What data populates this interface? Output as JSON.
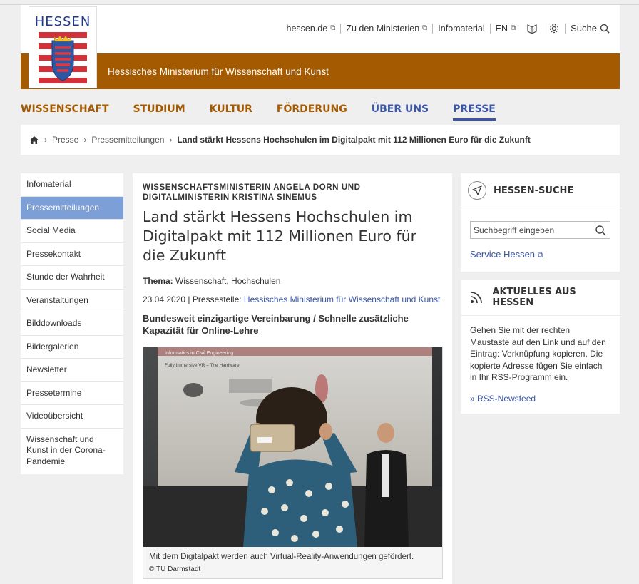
{
  "header": {
    "logo_text": "HESSEN",
    "utility": [
      {
        "label": "hessen.de",
        "external": true
      },
      {
        "label": "Zu den Ministerien",
        "external": true
      },
      {
        "label": "Infomaterial",
        "external": false
      },
      {
        "label": "EN",
        "external": true
      }
    ],
    "search_label": "Suche",
    "ministry": "Hessisches Ministerium für Wissenschaft und Kunst"
  },
  "nav": [
    "WISSENSCHAFT",
    "STUDIUM",
    "KULTUR",
    "FÖRDERUNG",
    "ÜBER UNS",
    "PRESSE"
  ],
  "breadcrumb": {
    "items": [
      "Presse",
      "Pressemitteilungen"
    ],
    "current": "Land stärkt Hessens Hochschulen im Digitalpakt mit 112 Millionen Euro für die Zukunft"
  },
  "sidebar": {
    "active_index": 1,
    "items": [
      "Infomaterial",
      "Pressemitteilungen",
      "Social Media",
      "Pressekontakt",
      "Stunde der Wahrheit",
      "Veranstaltungen",
      "Bilddownloads",
      "Bildergalerien",
      "Newsletter",
      "Pressetermine",
      "Videoübersicht",
      "Wissenschaft und Kunst in der Corona-Pandemie"
    ]
  },
  "article": {
    "kicker": "WISSENSCHAFTSMINISTERIN ANGELA DORN UND DIGITALMINISTERIN KRISTINA SINEMUS",
    "headline": "Land stärkt Hessens Hochschulen im Digitalpakt mit 112 Millionen Euro für die Zukunft",
    "topic_label": "Thema:",
    "topic": "Wissenschaft, Hochschulen",
    "date": "23.04.2020",
    "source_label": "Pressestelle:",
    "source": "Hessisches Ministerium für Wissenschaft und Kunst",
    "lead": "Bundesweit einzigartige Vereinbarung / Schnelle zusätzliche Kapazität für Online-Lehre",
    "image_slide_title": "Informatics in Civil Engineering",
    "image_slide_subtitle": "Fully Immersive VR – The Hardware",
    "caption": "Mit dem Digitalpakt werden auch Virtual-Reality-Anwendungen gefördert.",
    "credit": "© TU Darmstadt"
  },
  "search_box": {
    "title": "HESSEN-SUCHE",
    "placeholder": "Suchbegriff eingeben",
    "link": "Service Hessen"
  },
  "news_box": {
    "title": "AKTUELLES AUS HESSEN",
    "text": "Gehen Sie mit der rechten Maustaste auf den Link und auf den Eintrag: Verknüpfung kopieren. Die kopierte Adresse fügen Sie einfach in Ihr RSS-Programm ein.",
    "link": "» RSS-Newsfeed"
  },
  "colors": {
    "brand_orange": "#a35a00",
    "link_blue": "#3a56a5",
    "active_sidebar": "#7b9fd6"
  }
}
